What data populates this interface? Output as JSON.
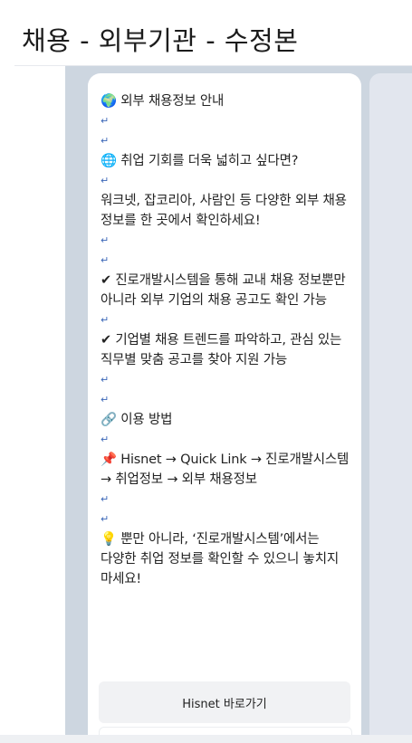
{
  "page": {
    "title": "채용 - 외부기관 - 수정본"
  },
  "card": {
    "para_mark": "↵",
    "lines": {
      "l01": "🌍 외부 채용정보 안내",
      "l02": "🌐 취업 기회를 더욱 넓히고 싶다면?",
      "l03": "워크넷, 잡코리아, 사람인 등 다양한 외부 채용 정보를 한 곳에서 확인하세요!",
      "l04": "✔ 진로개발시스템을 통해 교내 채용 정보뿐만 아니라 외부 기업의 채용 공고도 확인 가능",
      "l05": "✔ 기업별 채용 트렌드를 파악하고, 관심 있는 직무별 맞춤 공고를 찾아 지원 가능",
      "l06": "🔗 이용 방법",
      "l07": "📌 Hisnet → Quick Link → 진로개발시스템 → 취업정보 → 외부 채용정보",
      "l08": "💡 뿐만 아니라, ‘진로개발시스템’에서는 다양한 취업 정보를 확인할 수 있으니 놓치지 마세요!"
    }
  },
  "actions": {
    "hisnet_button": "Hisnet 바로가기"
  },
  "colors": {
    "canvas": "#cdd6e0",
    "card": "#ffffff",
    "para_mark": "#3b67b8"
  }
}
